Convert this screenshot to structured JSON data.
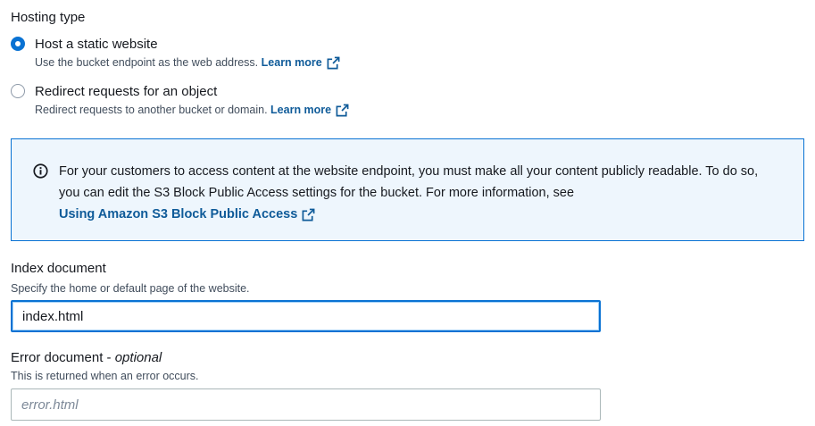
{
  "hosting_type": {
    "label": "Hosting type",
    "options": [
      {
        "title": "Host a static website",
        "description": "Use the bucket endpoint as the web address.",
        "link": "Learn more",
        "selected": true
      },
      {
        "title": "Redirect requests for an object",
        "description": "Redirect requests to another bucket or domain.",
        "link": "Learn more",
        "selected": false
      }
    ]
  },
  "info_alert": {
    "icon": "info-icon",
    "text": "For your customers to access content at the website endpoint, you must make all your content publicly readable. To do so, you can edit the S3 Block Public Access settings for the bucket. For more information, see",
    "link": "Using Amazon S3 Block Public Access"
  },
  "index_document": {
    "label": "Index document",
    "description": "Specify the home or default page of the website.",
    "value": "index.html"
  },
  "error_document": {
    "label": "Error document",
    "label_optional": "optional",
    "description": "This is returned when an error occurs.",
    "value": "",
    "placeholder": "error.html"
  },
  "colors": {
    "accent": "#0972d3",
    "link": "#0f5b99",
    "info_bg": "#eef6fd"
  }
}
